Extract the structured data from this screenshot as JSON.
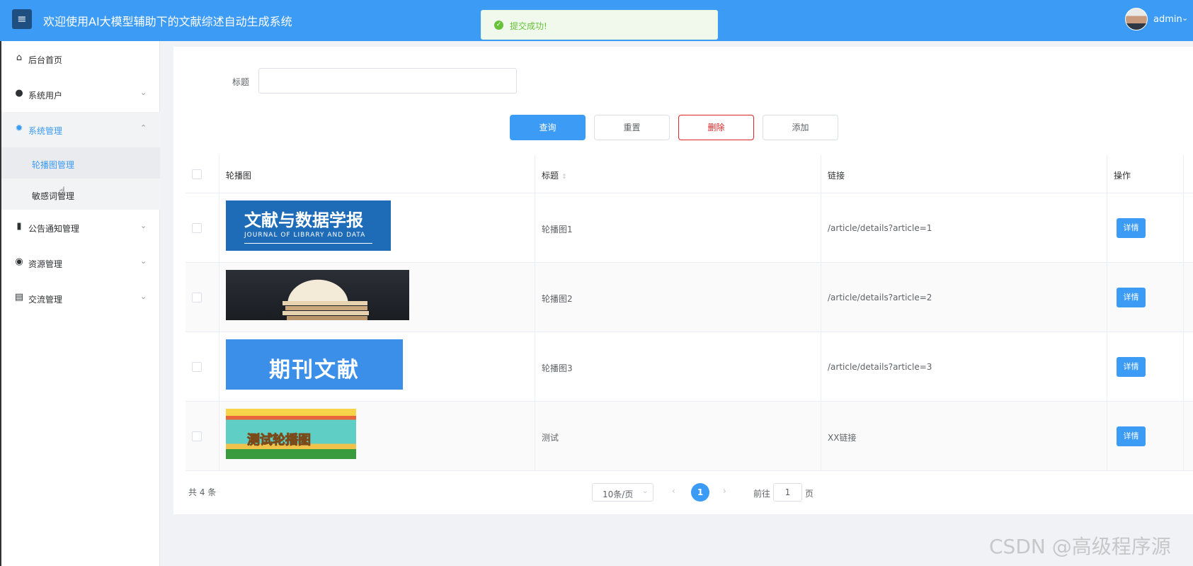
{
  "header": {
    "menu_icon": "hamburger-icon",
    "title": "欢迎使用AI大模型辅助下的文献综述自动生成系统",
    "user": "admin",
    "bg_color": "#3c9bf5"
  },
  "toast": {
    "icon": "check-circle-icon",
    "message": "提交成功!"
  },
  "sidebar": {
    "items": [
      {
        "label": "后台首页",
        "icon": "home-icon"
      },
      {
        "label": "系统用户",
        "icon": "user-icon"
      },
      {
        "label": "系统管理",
        "icon": "gear-icon",
        "expanded": true,
        "children": [
          {
            "label": "轮播图管理",
            "selected": true
          },
          {
            "label": "敏感词管理"
          }
        ]
      },
      {
        "label": "公告通知管理",
        "icon": "notice-icon"
      },
      {
        "label": "资源管理",
        "icon": "resource-icon"
      },
      {
        "label": "交流管理",
        "icon": "chat-icon"
      }
    ]
  },
  "filter": {
    "label": "标题",
    "value": ""
  },
  "buttons": {
    "query": "查询",
    "reset": "重置",
    "delete": "删除",
    "add": "添加"
  },
  "table": {
    "headers": {
      "image": "轮播图",
      "title": "标题",
      "link": "链接",
      "action": "操作"
    },
    "rows": [
      {
        "banner_text": "文献与数据学报",
        "banner_sub": "JOURNAL OF LIBRARY AND DATA",
        "title": "轮播图1",
        "link": "/article/details?article=1",
        "action": "详情"
      },
      {
        "banner_text": "",
        "title": "轮播图2",
        "link": "/article/details?article=2",
        "action": "详情"
      },
      {
        "banner_text": "期刊文献",
        "title": "轮播图3",
        "link": "/article/details?article=3",
        "action": "详情"
      },
      {
        "banner_text": "测试轮播图",
        "title": "测试",
        "link": "XX链接",
        "action": "详情"
      }
    ]
  },
  "pagination": {
    "total": "共 4 条",
    "page_size": "10条/页",
    "current": "1",
    "goto_label": "前往",
    "goto_value": "1",
    "goto_suffix": "页"
  },
  "watermark": "CSDN @高级程序源"
}
